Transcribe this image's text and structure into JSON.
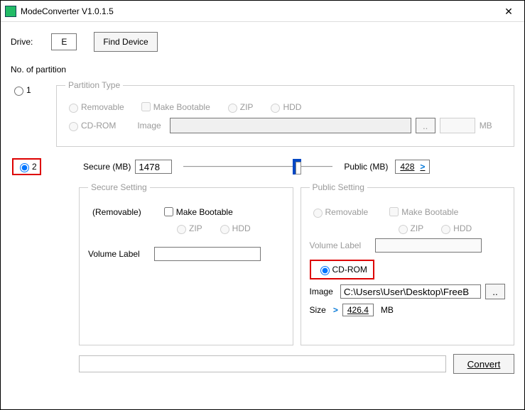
{
  "window": {
    "title": "ModeConverter V1.0.1.5",
    "close_glyph": "✕"
  },
  "drive": {
    "label": "Drive:",
    "value": "E",
    "find_button": "Find Device"
  },
  "partition": {
    "count_label": "No. of partition",
    "opt1": "1",
    "opt2": "2",
    "type_legend": "Partition Type",
    "removable": "Removable",
    "make_bootable": "Make Bootable",
    "zip": "ZIP",
    "hdd": "HDD",
    "cdrom": "CD-ROM",
    "image_label": "Image",
    "browse": "..",
    "mb": "MB"
  },
  "slider": {
    "secure_label": "Secure (MB)",
    "secure_value": "1478",
    "public_label": "Public (MB)",
    "public_value": "428",
    "gt": ">"
  },
  "secure_setting": {
    "legend": "Secure Setting",
    "removable": "(Removable)",
    "make_bootable": "Make Bootable",
    "zip": "ZIP",
    "hdd": "HDD",
    "volume_label": "Volume Label"
  },
  "public_setting": {
    "legend": "Public Setting",
    "removable": "Removable",
    "make_bootable": "Make Bootable",
    "zip": "ZIP",
    "hdd": "HDD",
    "volume_label": "Volume Label",
    "cdrom": "CD-ROM",
    "image_label": "Image",
    "image_path": "C:\\Users\\User\\Desktop\\FreeB",
    "browse": "..",
    "size_label": "Size",
    "gt": ">",
    "size_value": "426.4",
    "mb": "MB"
  },
  "footer": {
    "convert": "Convert"
  }
}
